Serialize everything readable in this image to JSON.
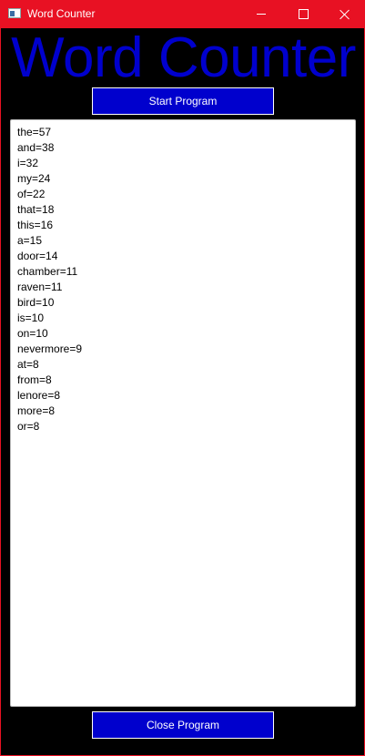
{
  "window": {
    "title": "Word Counter",
    "accent_color": "#e81123",
    "icon": "app-window-icon",
    "controls": {
      "minimize_icon": "minimize-icon",
      "maximize_icon": "maximize-icon",
      "close_icon": "close-icon"
    }
  },
  "main": {
    "heading": "Word Counter",
    "heading_color": "#0000cd",
    "start_button_label": "Start Program",
    "close_button_label": "Close Program",
    "button_color": "#0000cd",
    "results": [
      "the=57",
      "and=38",
      "i=32",
      "my=24",
      "of=22",
      "that=18",
      "this=16",
      "a=15",
      "door=14",
      "chamber=11",
      "raven=11",
      "bird=10",
      "is=10",
      "on=10",
      "nevermore=9",
      "at=8",
      "from=8",
      "lenore=8",
      "more=8",
      "or=8"
    ]
  }
}
